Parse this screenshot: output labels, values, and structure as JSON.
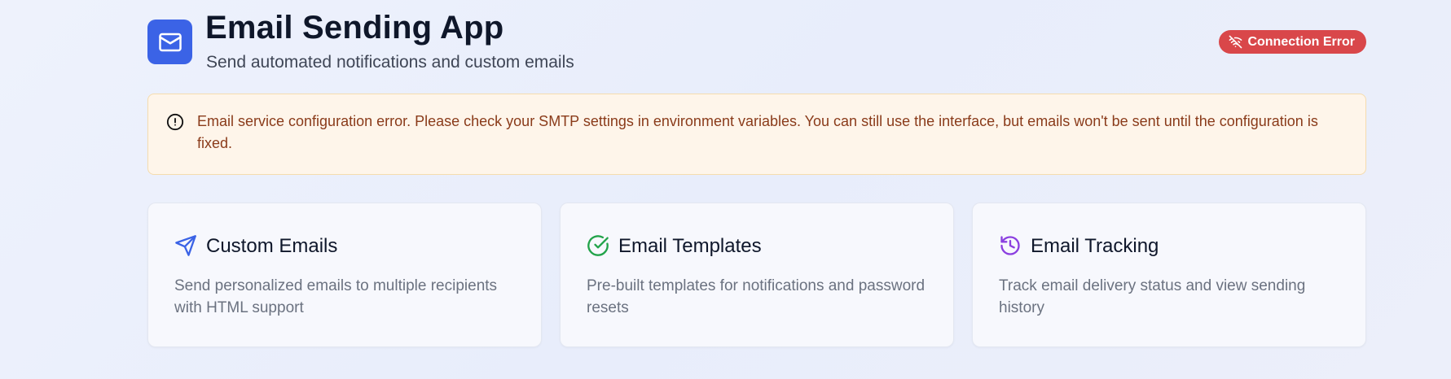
{
  "header": {
    "logo_icon": "mail-icon",
    "title": "Email Sending App",
    "subtitle": "Send automated notifications and custom emails",
    "status_icon": "wifi-off-icon",
    "status_label": "Connection Error",
    "status_color": "#d9474a",
    "brand_color": "#3b63e6"
  },
  "alert": {
    "icon": "alert-circle-icon",
    "message": "Email service configuration error. Please check your SMTP settings in environment variables. You can still use the interface, but emails won't be sent until the configuration is fixed."
  },
  "features": [
    {
      "icon": "send-icon",
      "icon_color": "#3b63e6",
      "title": "Custom Emails",
      "description": "Send personalized emails to multiple recipients with HTML support"
    },
    {
      "icon": "check-circle-icon",
      "icon_color": "#22a34a",
      "title": "Email Templates",
      "description": "Pre-built templates for notifications and password resets"
    },
    {
      "icon": "history-icon",
      "icon_color": "#8b3fe0",
      "title": "Email Tracking",
      "description": "Track email delivery status and view sending history"
    }
  ]
}
